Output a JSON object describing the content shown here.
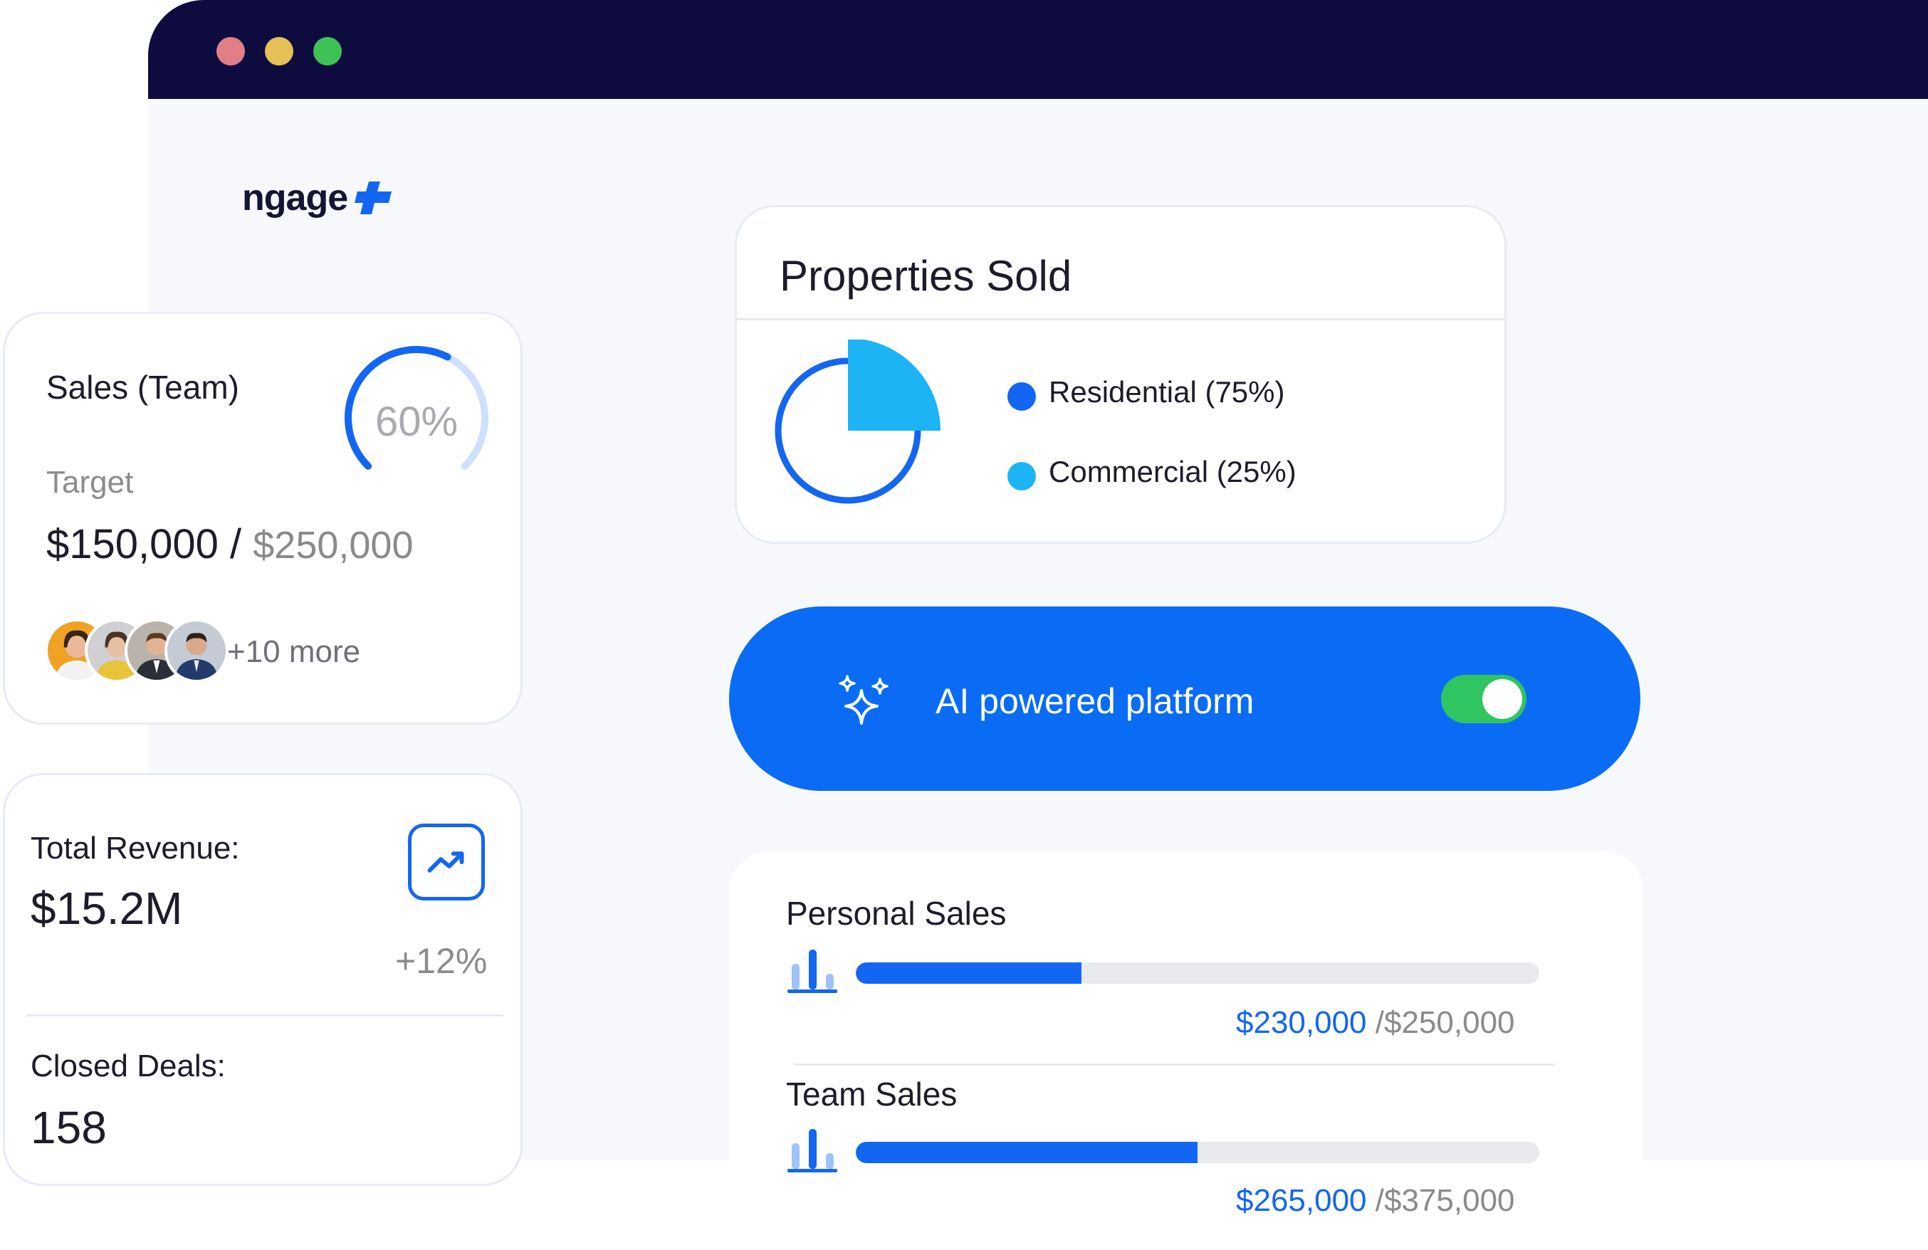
{
  "brand": {
    "logo_text": "ngage"
  },
  "sales_team": {
    "title": "Sales (Team)",
    "percent_label": "60%",
    "progress_fraction": 0.6,
    "target_label": "Target",
    "current": "$150,000",
    "separator": " / ",
    "goal": "$250,000",
    "more_label": "+10 more"
  },
  "revenue": {
    "total_label": "Total Revenue:",
    "total_value": "$15.2M",
    "change": "+12%",
    "icon": "trending-up-icon",
    "deals_label": "Closed Deals:",
    "deals_value": "158"
  },
  "properties": {
    "title": "Properties Sold",
    "legend": [
      {
        "label": "Residential (75%)",
        "color": "#1366f1",
        "percent": 75
      },
      {
        "label": "Commercial (25%)",
        "color": "#1cb4f5",
        "percent": 25
      }
    ]
  },
  "ai": {
    "label": "AI powered platform",
    "icon": "sparkle-icon",
    "toggle_on": true
  },
  "personal_sales": {
    "title": "Personal Sales",
    "current": "$230,000",
    "separator": " /",
    "goal": "$250,000",
    "progress_fraction": 0.33
  },
  "team_sales": {
    "title": "Team Sales",
    "current": "$265,000",
    "separator": " /",
    "goal": "$375,000",
    "progress_fraction": 0.5
  },
  "colors": {
    "accent": "#1366f1",
    "accent_light": "#1cb4f5",
    "titlebar": "#0e0c3f",
    "toggle_on": "#2fc560"
  }
}
